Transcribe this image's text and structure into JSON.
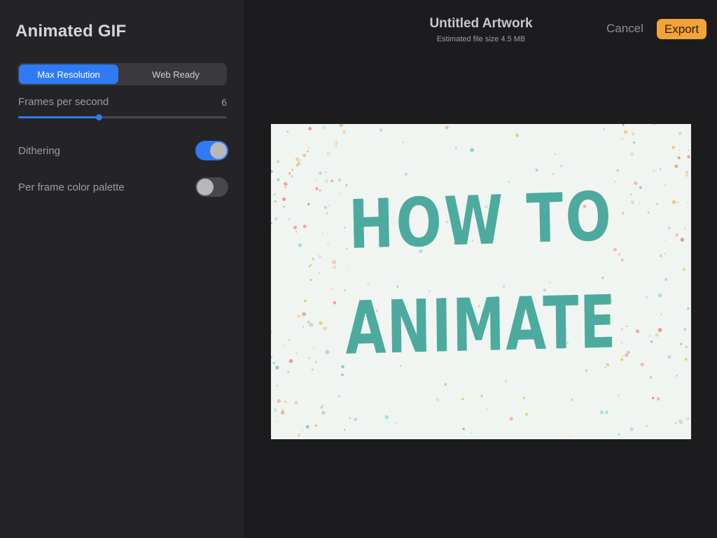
{
  "panel": {
    "title": "Animated GIF",
    "resolution_tabs": [
      {
        "label": "Max Resolution",
        "selected": true
      },
      {
        "label": "Web Ready",
        "selected": false
      }
    ],
    "fps": {
      "label": "Frames per second",
      "value": "6",
      "slider_fraction": 0.385
    },
    "dithering": {
      "label": "Dithering",
      "on": true
    },
    "per_frame_palette": {
      "label": "Per frame color palette",
      "on": false
    }
  },
  "header": {
    "title": "Untitled Artwork",
    "subtitle": "Estimated file size 4.5 MB",
    "cancel_label": "Cancel",
    "export_label": "Export"
  },
  "artwork": {
    "line1": "HOW TO",
    "line2": "ANIMATE",
    "text_color": "#4daa9e",
    "background": "#f1f5f2",
    "speckle_colors": [
      "#e9c36a",
      "#7fc9c4",
      "#e98a7e",
      "#a9dcd6",
      "#f2b2a6"
    ]
  },
  "colors": {
    "accent": "#2f7bf5",
    "export": "#f4a23a",
    "background": "#1c1c1e",
    "panel": "#242426"
  }
}
